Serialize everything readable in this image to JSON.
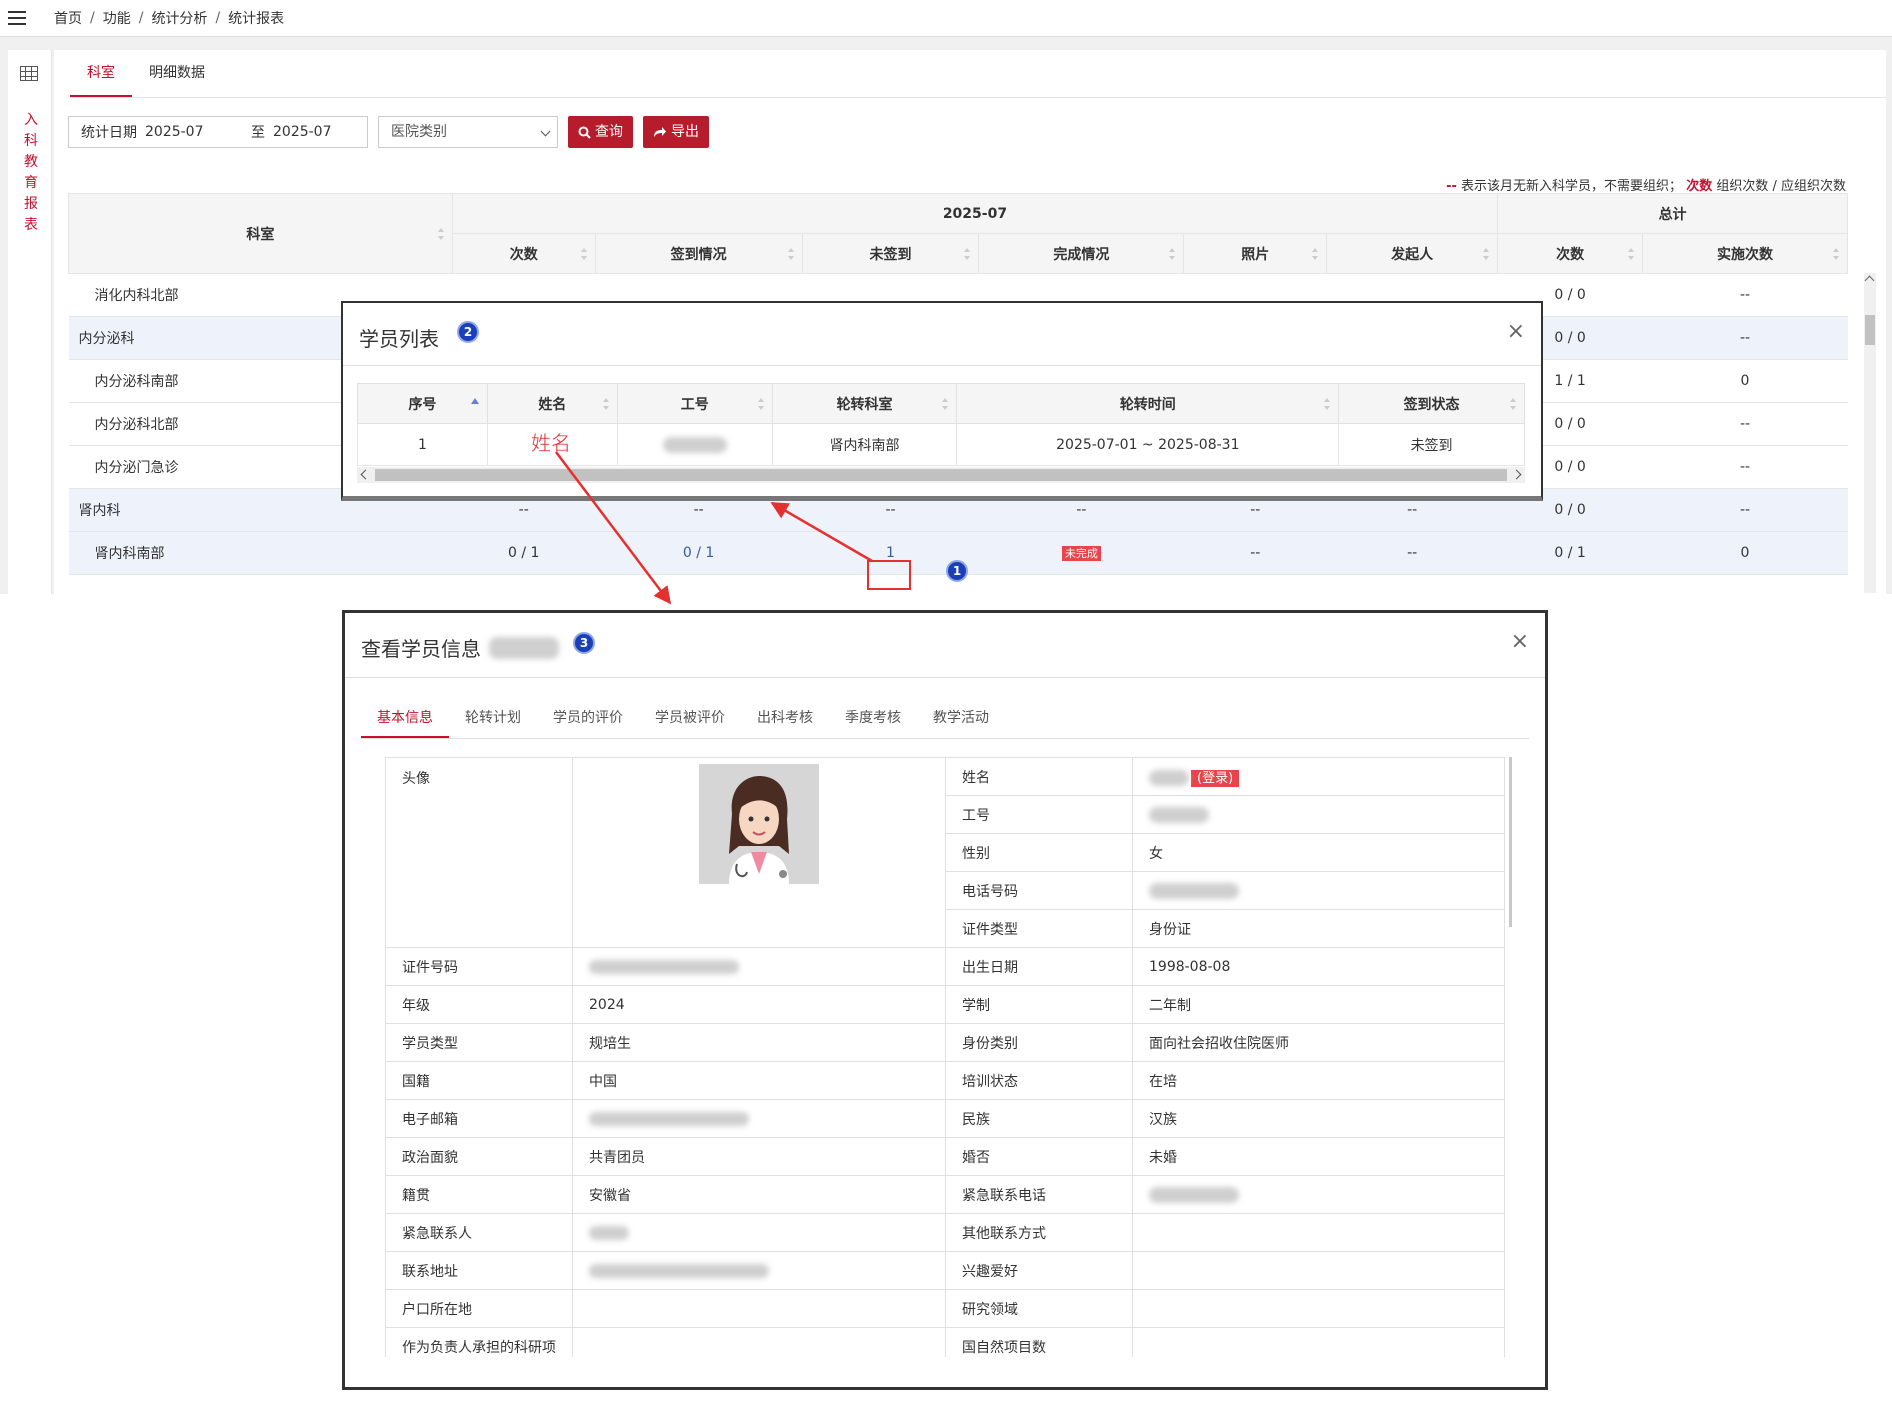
{
  "breadcrumb": [
    "首页",
    "功能",
    "统计分析",
    "统计报表"
  ],
  "sidebar": {
    "title": "入科教育报表"
  },
  "tabs": [
    "科室",
    "明细数据"
  ],
  "filter": {
    "date_label": "统计日期",
    "date_from": "2025-07",
    "date_sep": "至",
    "date_to": "2025-07",
    "hospital_select": "医院类别",
    "query_button": "查询",
    "export_button": "导出"
  },
  "legend": {
    "dash": "--",
    "dash_text": "表示该月无新入科学员，不需要组织；",
    "count_word": "次数",
    "count_text": "组织次数 / 应组织次数"
  },
  "stats_table": {
    "col_dept": "科室",
    "group_month": "2025-07",
    "group_total": "总计",
    "columns": [
      "次数",
      "签到情况",
      "未签到",
      "完成情况",
      "照片",
      "发起人",
      "次数",
      "实施次数"
    ],
    "rows": [
      {
        "dept": "消化内科北部",
        "level": "sub",
        "cells": [
          "",
          "",
          "",
          "",
          "",
          "",
          "0 / 0",
          "--"
        ]
      },
      {
        "dept": "内分泌科",
        "level": "top",
        "cells": [
          "",
          "",
          "",
          "",
          "",
          "",
          "0 / 0",
          "--"
        ]
      },
      {
        "dept": "内分泌科南部",
        "level": "sub",
        "cells": [
          "",
          "",
          "",
          "",
          "",
          "",
          "1 / 1",
          "0"
        ]
      },
      {
        "dept": "内分泌科北部",
        "level": "sub",
        "cells": [
          "",
          "",
          "",
          "",
          "",
          "",
          "0 / 0",
          "--"
        ]
      },
      {
        "dept": "内分泌门急诊",
        "level": "sub",
        "cells": [
          "",
          "",
          "",
          "",
          "",
          "",
          "0 / 0",
          "--"
        ]
      },
      {
        "dept": "肾内科",
        "level": "top",
        "cells": [
          "--",
          "--",
          "--",
          "--",
          "--",
          "--",
          "0 / 0",
          "--"
        ]
      },
      {
        "dept": "肾内科南部",
        "level": "sub",
        "cells": [
          "0 / 1",
          "0 / 1",
          "1",
          "未完成",
          "--",
          "--",
          "0 / 1",
          "0"
        ]
      }
    ]
  },
  "student_modal": {
    "title": "学员列表",
    "badge": "2",
    "close": "×",
    "columns": [
      "序号",
      "姓名",
      "工号",
      "轮转科室",
      "轮转时间",
      "签到状态"
    ],
    "rows": [
      {
        "index": "1",
        "name": "",
        "id": "",
        "dept": "肾内科南部",
        "time": "2025-07-01 ~ 2025-08-31",
        "status": "未签到"
      }
    ]
  },
  "annotations": {
    "name_label": "姓名",
    "badge1": "1"
  },
  "info_modal": {
    "title": "查看学员信息",
    "badge": "3",
    "close": "×",
    "tabs": [
      "基本信息",
      "轮转计划",
      "学员的评价",
      "学员被评价",
      "出科考核",
      "季度考核",
      "教学活动"
    ],
    "avatar_label": "头像",
    "login_badge": "(登录)",
    "right_top": [
      {
        "label": "姓名",
        "value": ""
      },
      {
        "label": "工号",
        "value": ""
      },
      {
        "label": "性别",
        "value": "女"
      },
      {
        "label": "电话号码",
        "value": ""
      },
      {
        "label": "证件类型",
        "value": "身份证"
      }
    ],
    "rows": [
      {
        "l1": "证件号码",
        "v1": "",
        "l2": "出生日期",
        "v2": "1998-08-08"
      },
      {
        "l1": "年级",
        "v1": "2024",
        "l2": "学制",
        "v2": "二年制"
      },
      {
        "l1": "学员类型",
        "v1": "规培生",
        "l2": "身份类别",
        "v2": "面向社会招收住院医师"
      },
      {
        "l1": "国籍",
        "v1": "中国",
        "l2": "培训状态",
        "v2": "在培"
      },
      {
        "l1": "电子邮箱",
        "v1": "",
        "l2": "民族",
        "v2": "汉族"
      },
      {
        "l1": "政治面貌",
        "v1": "共青团员",
        "l2": "婚否",
        "v2": "未婚"
      },
      {
        "l1": "籍贯",
        "v1": "安徽省",
        "l2": "紧急联系电话",
        "v2": ""
      },
      {
        "l1": "紧急联系人",
        "v1": "",
        "l2": "其他联系方式",
        "v2": ""
      },
      {
        "l1": "联系地址",
        "v1": "",
        "l2": "兴趣爱好",
        "v2": ""
      },
      {
        "l1": "户口所在地",
        "v1": "",
        "l2": "研究领域",
        "v2": ""
      },
      {
        "l1": "作为负责人承担的科研项",
        "v1": "",
        "l2": "国自然项目数",
        "v2": ""
      }
    ]
  },
  "colors": {
    "brand_red": "#b71c2c",
    "accent_red": "#c8102e",
    "annotation_red": "#e53030",
    "badge_blue": "#1a3fb8"
  }
}
